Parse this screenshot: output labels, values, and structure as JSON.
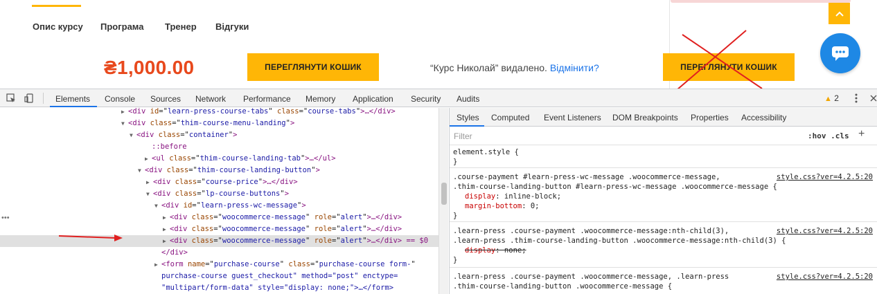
{
  "site": {
    "tabs": [
      "Опис курсу",
      "Програма",
      "Тренер",
      "Відгуки"
    ],
    "price": "₴1,000.00",
    "view_cart_1": "ПЕРЕГЛЯНУТИ КОШИК",
    "message_text": "“Курс Николай” видалено.",
    "message_link": "Відмінити?",
    "view_cart_2": "ПЕРЕГЛЯНУТИ КОШИК",
    "accent_color": "#ffb606",
    "price_color": "#e8491d"
  },
  "devtools": {
    "tabs": [
      "Elements",
      "Console",
      "Sources",
      "Network",
      "Performance",
      "Memory",
      "Application",
      "Security",
      "Audits"
    ],
    "active_tab": "Elements",
    "warnings": "2",
    "elements": [
      {
        "tw": "▶",
        "open": "<div",
        "attrs": [
          [
            "id",
            "learn-press-course-tabs"
          ],
          [
            "class",
            "course-tabs"
          ]
        ],
        "tail": ">…</div>"
      },
      {
        "tw": "▼",
        "open": "<div",
        "attrs": [
          [
            "class",
            "thim-course-menu-landing"
          ]
        ],
        "tail": ">"
      },
      {
        "tw": "▼",
        "open": "<div",
        "attrs": [
          [
            "class",
            "container"
          ]
        ],
        "tail": ">"
      },
      {
        "tw": "",
        "pseudo": "::before"
      },
      {
        "tw": "▶",
        "open": "<ul",
        "attrs": [
          [
            "class",
            "thim-course-landing-tab"
          ]
        ],
        "tail": ">…</ul>"
      },
      {
        "tw": "▼",
        "open": "<div",
        "attrs": [
          [
            "class",
            "thim-course-landing-button"
          ]
        ],
        "tail": ">"
      },
      {
        "tw": "▶",
        "open": "<div",
        "attrs": [
          [
            "class",
            "course-price"
          ]
        ],
        "tail": ">…</div>"
      },
      {
        "tw": "▼",
        "open": "<div",
        "attrs": [
          [
            "class",
            "lp-course-buttons"
          ]
        ],
        "tail": ">"
      },
      {
        "tw": "▼",
        "open": "<div",
        "attrs": [
          [
            "id",
            "learn-press-wc-message"
          ]
        ],
        "tail": ">"
      },
      {
        "tw": "▶",
        "open": "<div",
        "attrs": [
          [
            "class",
            "woocommerce-message"
          ],
          [
            "role",
            "alert"
          ]
        ],
        "tail": ">…</div>"
      },
      {
        "tw": "▶",
        "open": "<div",
        "attrs": [
          [
            "class",
            "woocommerce-message"
          ],
          [
            "role",
            "alert"
          ]
        ],
        "tail": ">…</div>"
      },
      {
        "tw": "▶",
        "open": "<div",
        "attrs": [
          [
            "class",
            "woocommerce-message"
          ],
          [
            "role",
            "alert"
          ]
        ],
        "tail": ">…</div> == $0",
        "selected": true
      },
      {
        "tw": "",
        "close": "</div>"
      },
      {
        "tw": "▶",
        "open": "<form",
        "attrs": [
          [
            "name",
            "purchase-course"
          ],
          [
            "class",
            "purchase-course form-"
          ]
        ],
        "tail": ""
      },
      {
        "tw": "",
        "text": "purchase-course guest_checkout\" method=\"post\" enctype="
      },
      {
        "tw": "",
        "text": "\"multipart/form-data\" style=\"display: none;\">…</form>"
      }
    ],
    "styles_tabs": [
      "Styles",
      "Computed",
      "Event Listeners",
      "DOM Breakpoints",
      "Properties",
      "Accessibility"
    ],
    "filter_placeholder": "Filter",
    "hov_cls": ":hov  .cls",
    "rules": [
      {
        "selector": [
          "element.style {"
        ],
        "props": [],
        "close": "}",
        "source": ""
      },
      {
        "selector": [
          ".course-payment #learn-press-wc-message .woocommerce-message,",
          ".thim-course-landing-button #learn-press-wc-message .woocommerce-message {"
        ],
        "props": [
          [
            "display",
            "inline-block",
            false
          ],
          [
            "margin-bottom",
            "0",
            false
          ]
        ],
        "close": "}",
        "source": "style.css?ver=4.2.5:20"
      },
      {
        "selector": [
          ".learn-press .course-payment .woocommerce-message:nth-child(3),",
          ".learn-press .thim-course-landing-button .woocommerce-message:nth-child(3) {"
        ],
        "props": [
          [
            "display",
            "none",
            true
          ]
        ],
        "close": "}",
        "source": "style.css?ver=4.2.5:20"
      },
      {
        "selector": [
          ".learn-press .course-payment .woocommerce-message, .learn-press",
          ".thim-course-landing-button .woocommerce-message {"
        ],
        "props": [],
        "close": "",
        "source": "style.css?ver=4.2.5:20"
      }
    ]
  }
}
